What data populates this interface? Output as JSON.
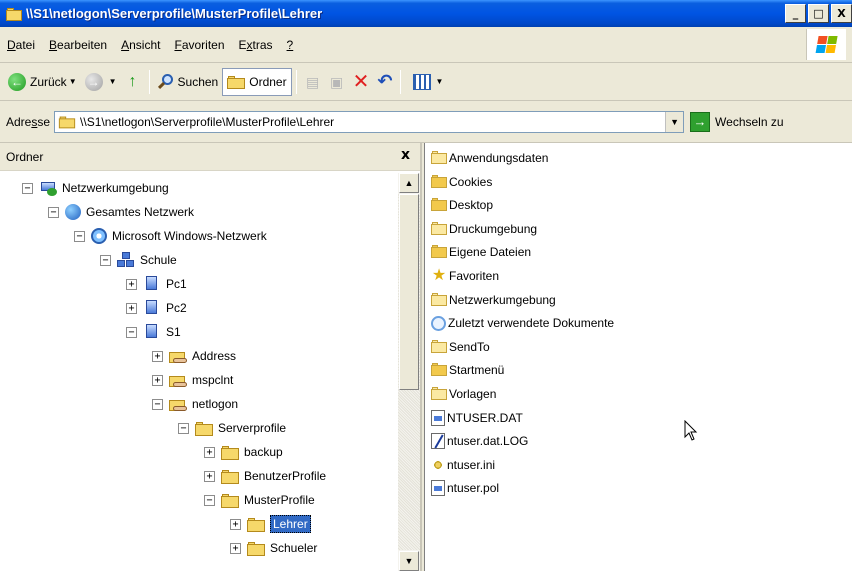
{
  "window": {
    "title": "\\\\S1\\netlogon\\Serverprofile\\MusterProfile\\Lehrer",
    "minimize": "_",
    "maximize": "□",
    "close": "X"
  },
  "menu": {
    "items": [
      {
        "u": "D",
        "rest": "atei"
      },
      {
        "u": "B",
        "rest": "earbeiten"
      },
      {
        "u": "A",
        "rest": "nsicht"
      },
      {
        "u": "F",
        "rest": "avoriten"
      },
      {
        "pre": "E",
        "u": "x",
        "rest": "tras"
      },
      {
        "u": "?",
        "rest": ""
      }
    ]
  },
  "toolbar": {
    "back": "Zurück",
    "search": "Suchen",
    "folders": "Ordner"
  },
  "address": {
    "label_pre": "Adre",
    "label_u": "s",
    "label_post": "se",
    "value": "\\\\S1\\netlogon\\Serverprofile\\MusterProfile\\Lehrer",
    "go": "Wechseln zu"
  },
  "folders_pane": {
    "title": "Ordner",
    "close": "x",
    "tree": [
      {
        "label": "Netzwerkumgebung",
        "exp": "−",
        "icon": "network-neighborhood-icon",
        "level": 0
      },
      {
        "label": "Gesamtes Netzwerk",
        "exp": "−",
        "icon": "globe-icon",
        "level": 1
      },
      {
        "label": "Microsoft Windows-Netzwerk",
        "exp": "−",
        "icon": "windows-network-icon",
        "level": 2
      },
      {
        "label": "Schule",
        "exp": "−",
        "icon": "workgroup-icon",
        "level": 3
      },
      {
        "label": "Pc1",
        "exp": "+",
        "icon": "computer-icon",
        "level": 4
      },
      {
        "label": "Pc2",
        "exp": "+",
        "icon": "computer-icon",
        "level": 4
      },
      {
        "label": "S1",
        "exp": "−",
        "icon": "computer-icon",
        "level": 4
      },
      {
        "label": "Address",
        "exp": "+",
        "icon": "shared-folder-icon",
        "level": 5
      },
      {
        "label": "mspclnt",
        "exp": "+",
        "icon": "shared-folder-icon",
        "level": 5
      },
      {
        "label": "netlogon",
        "exp": "−",
        "icon": "shared-folder-icon",
        "level": 5
      },
      {
        "label": "Serverprofile",
        "exp": "−",
        "icon": "folder-icon",
        "level": 6
      },
      {
        "label": "backup",
        "exp": "+",
        "icon": "folder-icon",
        "level": 7
      },
      {
        "label": "BenutzerProfile",
        "exp": "+",
        "icon": "folder-icon",
        "level": 7
      },
      {
        "label": "MusterProfile",
        "exp": "−",
        "icon": "folder-icon",
        "level": 7
      },
      {
        "label": "Lehrer",
        "exp": "+",
        "icon": "folder-icon",
        "level": 8,
        "selected": true
      },
      {
        "label": "Schueler",
        "exp": "+",
        "icon": "folder-icon",
        "level": 8
      }
    ]
  },
  "files": [
    {
      "name": "Anwendungsdaten",
      "type": "folder"
    },
    {
      "name": "Cookies",
      "type": "folder-full"
    },
    {
      "name": "Desktop",
      "type": "folder-full"
    },
    {
      "name": "Druckumgebung",
      "type": "folder"
    },
    {
      "name": "Eigene Dateien",
      "type": "folder-full"
    },
    {
      "name": "Favoriten",
      "type": "star"
    },
    {
      "name": "Netzwerkumgebung",
      "type": "folder"
    },
    {
      "name": "Zuletzt verwendete Dokumente",
      "type": "recent"
    },
    {
      "name": "SendTo",
      "type": "folder"
    },
    {
      "name": "Startmenü",
      "type": "folder-full"
    },
    {
      "name": "Vorlagen",
      "type": "folder"
    },
    {
      "name": "NTUSER.DAT",
      "type": "doc"
    },
    {
      "name": "ntuser.dat.LOG",
      "type": "log"
    },
    {
      "name": "ntuser.ini",
      "type": "ini"
    },
    {
      "name": "ntuser.pol",
      "type": "doc"
    }
  ],
  "colors": {
    "titlebar": "#0054e3",
    "selection": "#316ac5",
    "chrome": "#ece9d8"
  }
}
